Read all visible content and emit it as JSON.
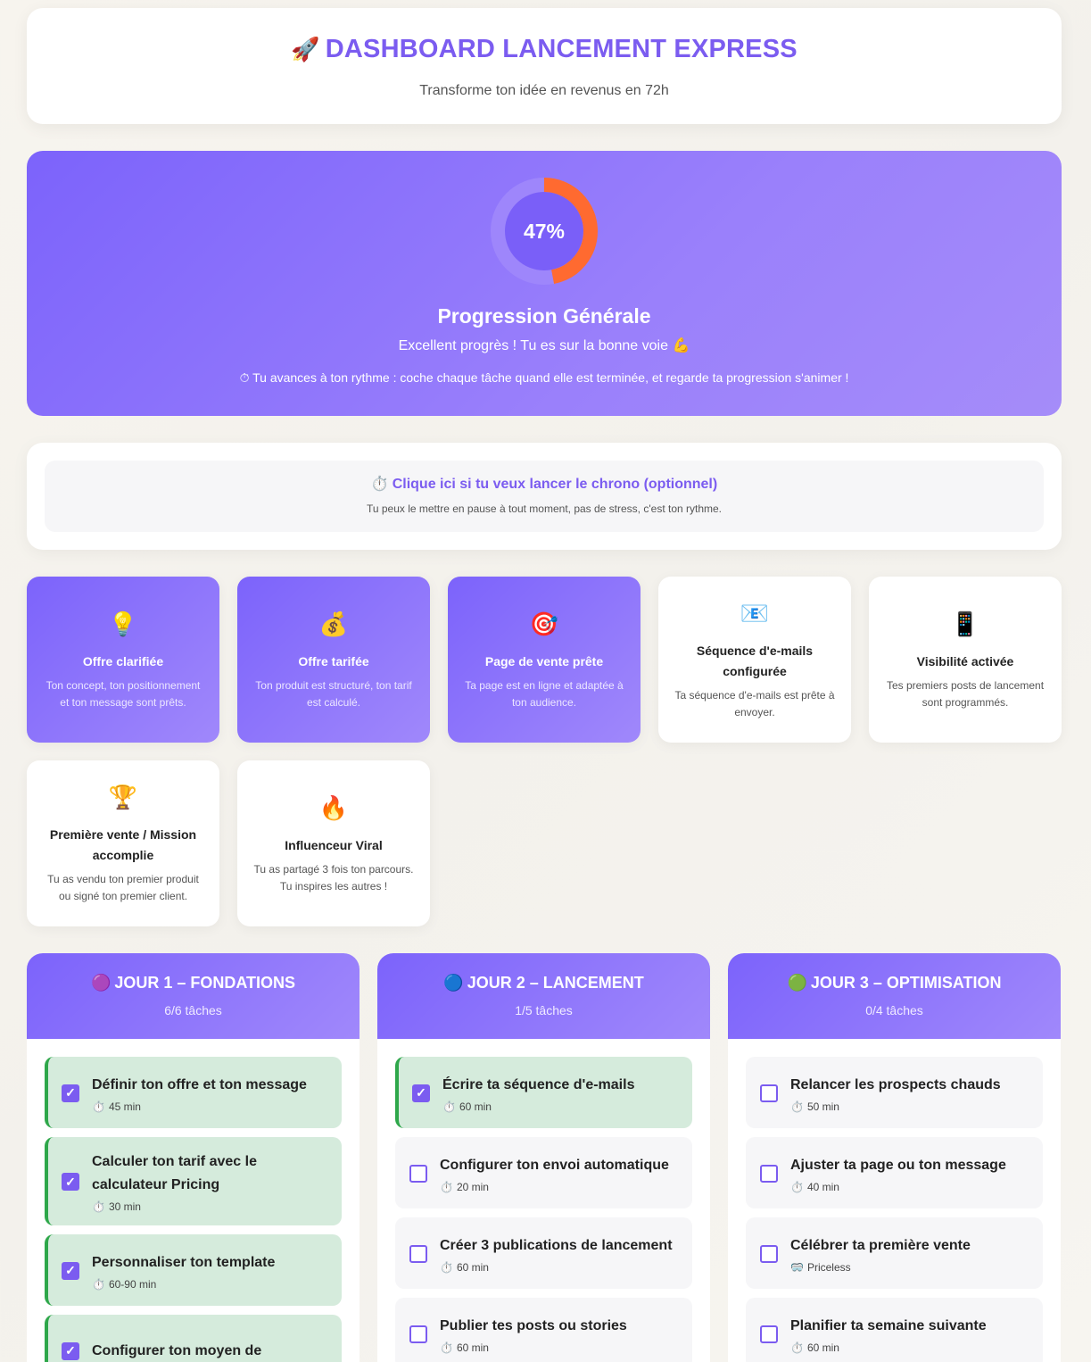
{
  "header": {
    "emoji": "🚀",
    "title": "DASHBOARD LANCEMENT EXPRESS",
    "subtitle": "Transforme ton idée en revenus en 72h"
  },
  "progress": {
    "percent_label": "47%",
    "percent": 47,
    "title": "Progression Générale",
    "message": "Excellent progrès ! Tu es sur la bonne voie 💪",
    "hint": "⏱ Tu avances à ton rythme : coche chaque tâche quand elle est terminée, et regarde ta progression s'animer !"
  },
  "chrono": {
    "emoji": "⏱️",
    "title": "Clique ici si tu veux lancer le chrono (optionnel)",
    "desc": "Tu peux le mettre en pause à tout moment, pas de stress, c'est ton rythme."
  },
  "badges": [
    {
      "icon": "💡",
      "title": "Offre clarifiée",
      "desc": "Ton concept, ton positionnement et ton message sont prêts."
    },
    {
      "icon": "💰",
      "title": "Offre tarifée",
      "desc": "Ton produit est structuré, ton tarif est calculé."
    },
    {
      "icon": "🎯",
      "title": "Page de vente prête",
      "desc": "Ta page est en ligne et adaptée à ton audience."
    },
    {
      "icon": "📧",
      "title": "Séquence d'e-mails configurée",
      "desc": "Ta séquence d'e-mails est prête à envoyer."
    },
    {
      "icon": "📱",
      "title": "Visibilité activée",
      "desc": "Tes premiers posts de lancement sont programmés."
    },
    {
      "icon": "🏆",
      "title": "Première vente / Mission accomplie",
      "desc": "Tu as vendu ton premier produit ou signé ton premier client."
    },
    {
      "icon": "🔥",
      "title": "Influenceur Viral",
      "desc": "Tu as partagé 3 fois ton parcours. Tu inspires les autres !"
    }
  ],
  "days": [
    {
      "emoji": "🟣",
      "title": "JOUR 1 – FONDATIONS",
      "count": "6/6 tâches",
      "tasks": [
        {
          "title": "Définir ton offre et ton message",
          "time_emoji": "⏱️",
          "time": "45 min"
        },
        {
          "title": "Calculer ton tarif avec le calculateur Pricing",
          "time_emoji": "⏱️",
          "time": "30 min"
        },
        {
          "title": "Personnaliser ton template",
          "time_emoji": "⏱️",
          "time": "60-90 min"
        },
        {
          "title": "Configurer ton moyen de",
          "time_emoji": "⏱️",
          "time": ""
        }
      ]
    },
    {
      "emoji": "🔵",
      "title": "JOUR 2 – LANCEMENT",
      "count": "1/5 tâches",
      "tasks": [
        {
          "title": "Écrire ta séquence d'e-mails",
          "time_emoji": "⏱️",
          "time": "60 min"
        },
        {
          "title": "Configurer ton envoi automatique",
          "time_emoji": "⏱️",
          "time": "20 min"
        },
        {
          "title": "Créer 3 publications de lancement",
          "time_emoji": "⏱️",
          "time": "60 min"
        },
        {
          "title": "Publier tes posts ou stories",
          "time_emoji": "⏱️",
          "time": "60 min"
        }
      ]
    },
    {
      "emoji": "🟢",
      "title": "JOUR 3 – OPTIMISATION",
      "count": "0/4 tâches",
      "tasks": [
        {
          "title": "Relancer les prospects chauds",
          "time_emoji": "⏱️",
          "time": "50 min"
        },
        {
          "title": "Ajuster ta page ou ton message",
          "time_emoji": "⏱️",
          "time": "40 min"
        },
        {
          "title": "Célébrer ta première vente",
          "time_emoji": "🥽",
          "time": "Priceless"
        },
        {
          "title": "Planifier ta semaine suivante",
          "time_emoji": "⏱️",
          "time": "60 min"
        }
      ]
    }
  ],
  "checkmark": "✓",
  "colors": {
    "accent": "#7b5cf0",
    "ring_track": "#9e86fb",
    "ring_progress": "#ff6a30",
    "done_bg": "#d5ebdc",
    "done_border": "#2ea74a"
  }
}
